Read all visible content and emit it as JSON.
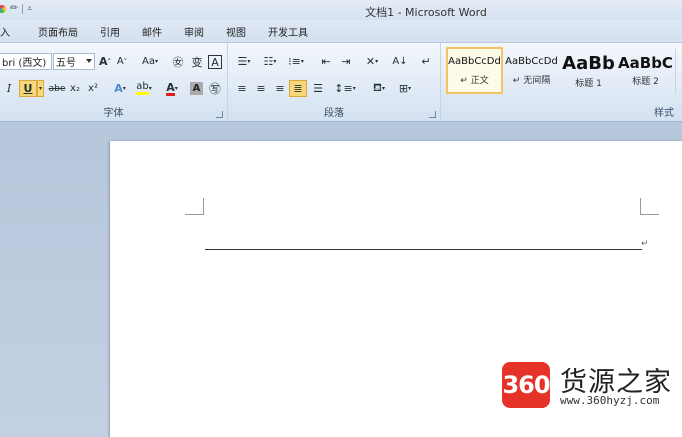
{
  "window": {
    "title": "文档1 - Microsoft Word"
  },
  "tabs": [
    "入",
    "页面布局",
    "引用",
    "邮件",
    "审阅",
    "视图",
    "开发工具"
  ],
  "font_group": {
    "label": "字体",
    "font_name": "bri (西文)",
    "font_size": "五号",
    "grow_label": "A",
    "shrink_label": "A",
    "case_label": "Aa",
    "italic_label": "I",
    "underline_label": "U",
    "strike_label": "abe",
    "sub_label": "x₂",
    "sup_label": "x²"
  },
  "paragraph_group": {
    "label": "段落"
  },
  "styles_group": {
    "label": "样式",
    "items": [
      {
        "sample": "AaBbCcDd",
        "name": "↵ 正文",
        "selected": true
      },
      {
        "sample": "AaBbCcDd",
        "name": "↵ 无间隔",
        "selected": false
      },
      {
        "sample": "AaBb",
        "name": "标题 1",
        "selected": false
      },
      {
        "sample": "AaBbC",
        "name": "标题 2",
        "selected": false
      }
    ]
  },
  "document": {
    "paragraph_mark": "↵"
  },
  "watermark": {
    "badge": "360",
    "name": "货源之家",
    "url": "www.360hyzj.com"
  },
  "colors": {
    "highlight": "#ffff00",
    "font_color": "#e02020",
    "selected_button": "#f8d779"
  }
}
